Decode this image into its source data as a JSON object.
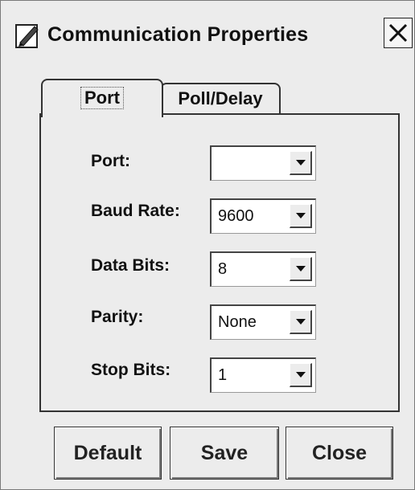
{
  "window": {
    "title": "Communication Properties",
    "icon": "edit-pencil-icon"
  },
  "tabs": [
    {
      "label": "Port",
      "selected": true
    },
    {
      "label": "Poll/Delay",
      "selected": false
    }
  ],
  "fields": {
    "port": {
      "label": "Port:",
      "value": ""
    },
    "baud_rate": {
      "label": "Baud Rate:",
      "value": "9600"
    },
    "data_bits": {
      "label": "Data Bits:",
      "value": "8"
    },
    "parity": {
      "label": "Parity:",
      "value": "None"
    },
    "stop_bits": {
      "label": "Stop Bits:",
      "value": "1"
    }
  },
  "buttons": {
    "default_label": "Default",
    "save_label": "Save",
    "close_label": "Close"
  },
  "colors": {
    "window_bg": "#ececec",
    "border": "#333333",
    "field_bg": "#ffffff"
  }
}
